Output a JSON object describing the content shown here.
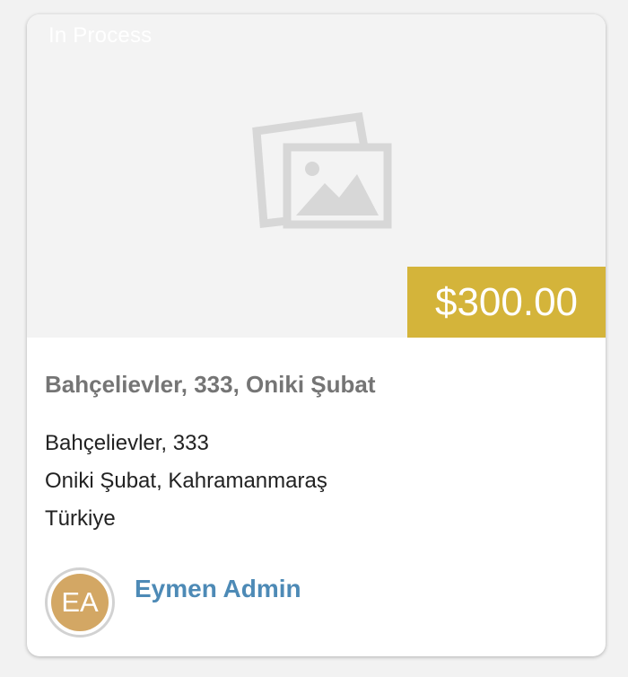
{
  "listing": {
    "status": "In Process",
    "price": "$300.00",
    "title": "Bahçelievler, 333, Oniki Şubat",
    "address_lines": [
      "Bahçelievler, 333",
      "Oniki Şubat, Kahramanmaraş",
      "Türkiye"
    ],
    "image_icon": "image-placeholder-icon"
  },
  "agent": {
    "initials": "EA",
    "name": "Eymen Admin"
  },
  "colors": {
    "price_bg": "#d4b43a",
    "agent_link": "#4d8ab6",
    "avatar_bg": "#d3a764",
    "title_text": "#757575"
  }
}
